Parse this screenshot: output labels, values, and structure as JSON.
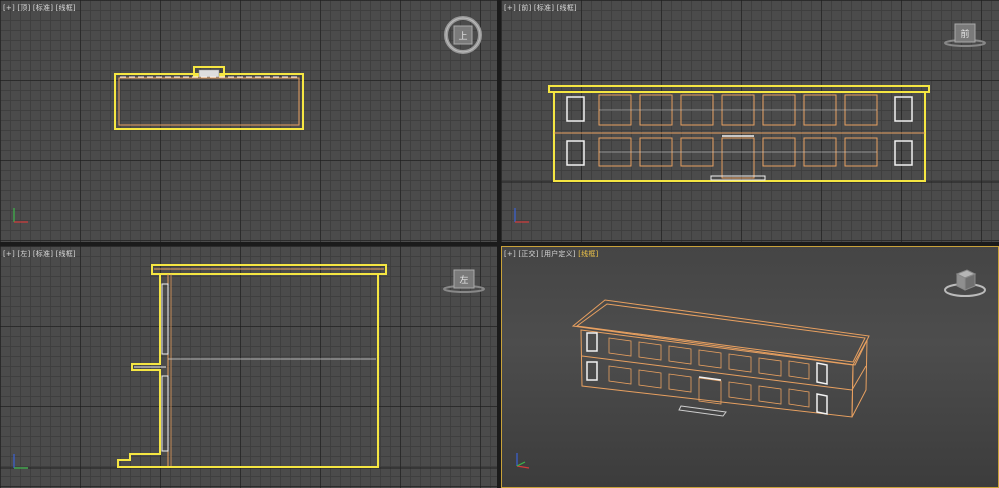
{
  "viewports": {
    "top": {
      "plus": "[+]",
      "view": "[顶]",
      "shading": "[标准]",
      "mode": "[线框]",
      "cube_label": "上"
    },
    "front": {
      "plus": "[+]",
      "view": "[前]",
      "shading": "[标准]",
      "mode": "[线框]",
      "cube_label": "前"
    },
    "left": {
      "plus": "[+]",
      "view": "[左]",
      "shading": "[标准]",
      "mode": "[线框]",
      "cube_label": "左"
    },
    "persp": {
      "plus": "[+]",
      "view": "[正交]",
      "shading": "[用户定义]",
      "mode": "[线框]"
    }
  },
  "colors": {
    "selection_yellow": "#f5e642",
    "wire_orange": "#e8a060",
    "wire_white": "#f2f2f2",
    "viewport_bg": "#4b4b4b",
    "active_border": "#c9a23a"
  },
  "icons": {
    "viewcube": "viewcube-icon",
    "axis": "axis-tripod-icon"
  }
}
